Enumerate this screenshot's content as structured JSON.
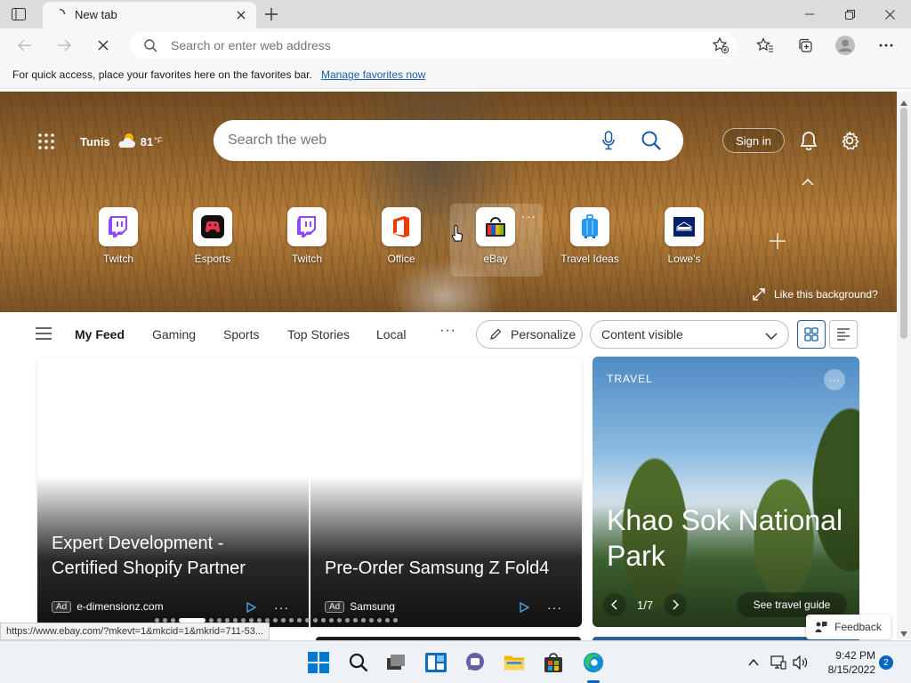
{
  "tab": {
    "title": "New tab"
  },
  "address": {
    "placeholder": "Search or enter web address"
  },
  "favbar": {
    "message": "For quick access, place your favorites here on the favorites bar.",
    "link": "Manage favorites now"
  },
  "hero": {
    "weather": {
      "city": "Tunis",
      "temp": "81",
      "unit": "°F"
    },
    "search_placeholder": "Search the web",
    "signin": "Sign in",
    "like_background": "Like this background?",
    "more_glyph": "···"
  },
  "quicklinks": [
    {
      "label": "Twitch",
      "icon": "twitch-icon"
    },
    {
      "label": "Esports",
      "icon": "esports-icon"
    },
    {
      "label": "Twitch",
      "icon": "twitch-icon"
    },
    {
      "label": "Office",
      "icon": "office-icon"
    },
    {
      "label": "eBay",
      "icon": "ebay-icon"
    },
    {
      "label": "Travel Ideas",
      "icon": "travel-ideas-icon"
    },
    {
      "label": "Lowe's",
      "icon": "lowes-icon"
    }
  ],
  "feed": {
    "tabs": [
      "My Feed",
      "Gaming",
      "Sports",
      "Top Stories",
      "Local"
    ],
    "more": "···",
    "personalize": "Personalize",
    "content_visibility": "Content visible"
  },
  "ads": [
    {
      "title": "Expert Development - Certified Shopify Partner",
      "badge": "Ad",
      "source": "e-dimensionz.com",
      "more": "···"
    },
    {
      "title": "Pre-Order Samsung Z Fold4",
      "badge": "Ad",
      "source": "Samsung",
      "more": "···"
    }
  ],
  "carousel": {
    "count": 28,
    "active": 3
  },
  "travel": {
    "category": "TRAVEL",
    "more": "···",
    "title": "Khao Sok National Park",
    "pager": "1/7",
    "guide": "See travel guide"
  },
  "status_url": "https://www.ebay.com/?mkevt=1&mkcid=1&mkrid=711-53...",
  "feedback": "Feedback",
  "clock": {
    "time": "9:42 PM",
    "date": "8/15/2022"
  },
  "notification_count": "2",
  "colors": {
    "accent": "#0067c0",
    "link": "#1a5ea8"
  }
}
